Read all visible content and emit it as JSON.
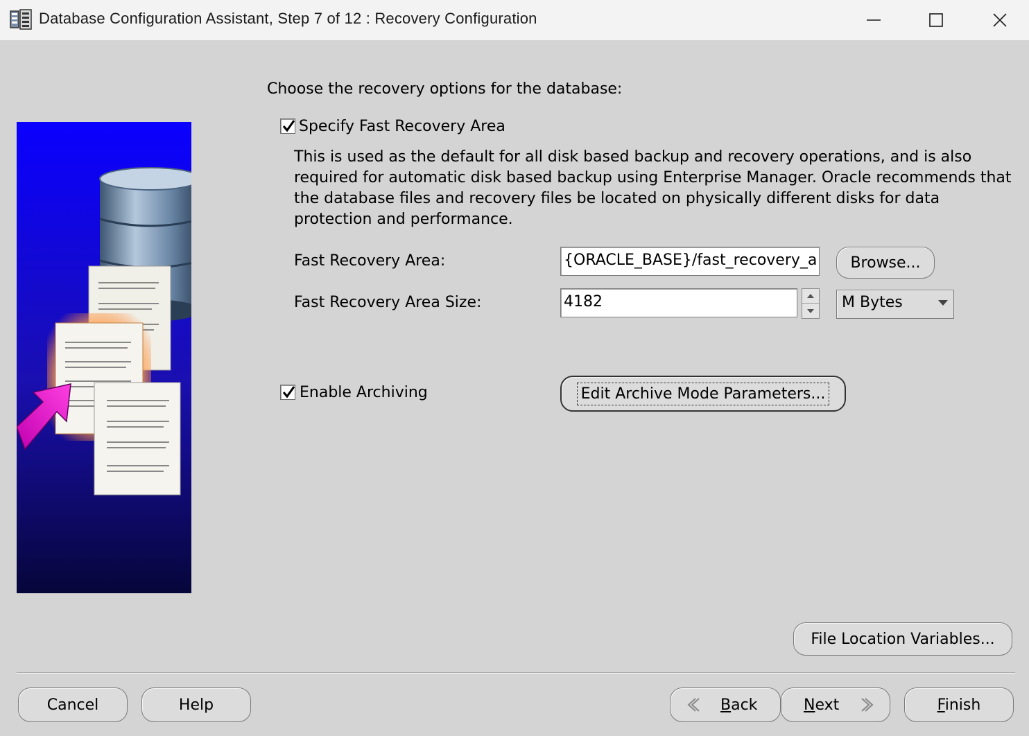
{
  "window": {
    "title": "Database Configuration Assistant, Step 7 of 12 : Recovery Configuration",
    "icons": {
      "app": "dbca-app-icon",
      "minimize": "minimize-icon",
      "maximize": "maximize-icon",
      "close": "close-icon"
    }
  },
  "banner": {
    "icon": "database-recovery-illustration"
  },
  "content": {
    "heading": "Choose the recovery options for the database:",
    "specify_fra": {
      "label": "Specify Fast Recovery Area",
      "checked": true
    },
    "description": "This is used as the default for all disk based backup and recovery operations, and is also required for automatic disk based backup using Enterprise Manager. Oracle recommends that the database files and recovery files be located on physically different disks for data protection and performance.",
    "fra_location": {
      "label": "Fast Recovery Area:",
      "value": "{ORACLE_BASE}/fast_recovery_a"
    },
    "browse_label": "Browse...",
    "fra_size": {
      "label": "Fast Recovery Area Size:",
      "value": "4182"
    },
    "size_unit": {
      "selected": "M Bytes"
    },
    "enable_archiving": {
      "label": "Enable Archiving",
      "checked": true
    },
    "edit_archive_label": "Edit Archive Mode Parameters...",
    "file_location_label": "File Location Variables..."
  },
  "footer": {
    "cancel": "Cancel",
    "help": "Help",
    "back_mnemonic": "B",
    "back_rest": "ack",
    "next_mnemonic": "N",
    "next_rest": "ext",
    "finish_mnemonic": "F",
    "finish_rest": "inish"
  }
}
